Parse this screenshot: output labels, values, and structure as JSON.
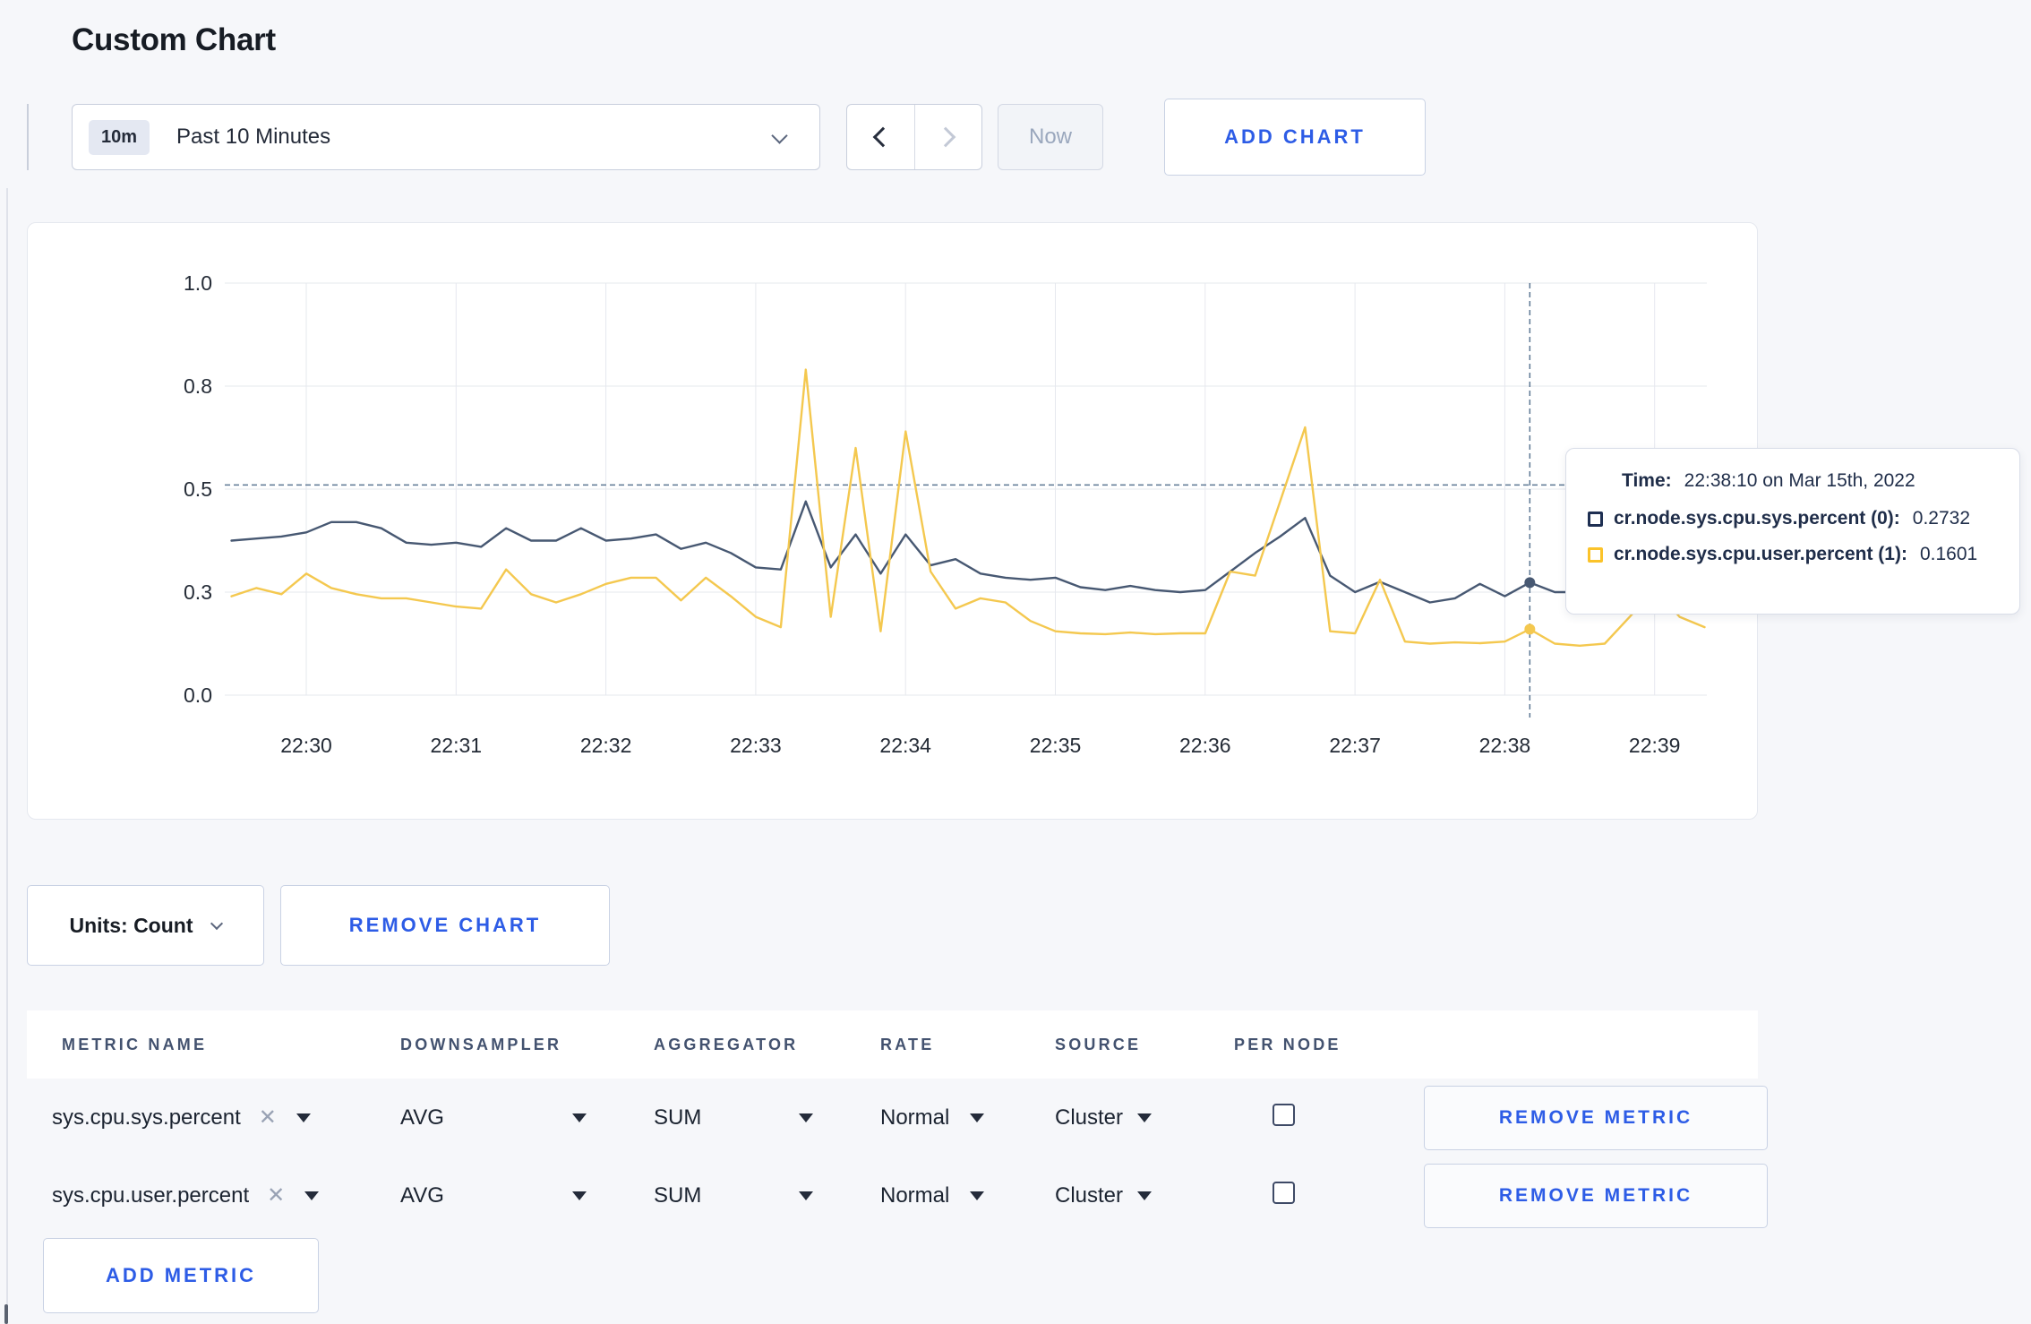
{
  "page": {
    "title": "Custom Chart"
  },
  "toolbar": {
    "time_range": {
      "badge": "10m",
      "label": "Past 10 Minutes"
    },
    "now_label": "Now",
    "add_chart_label": "ADD CHART"
  },
  "tooltip": {
    "time_label": "Time:",
    "time_value": "22:38:10 on Mar 15th, 2022",
    "series": [
      {
        "name": "cr.node.sys.cpu.sys.percent (0):",
        "value": "0.2732",
        "color": "#1e2f52"
      },
      {
        "name": "cr.node.sys.cpu.user.percent (1):",
        "value": "0.1601",
        "color": "#fbc32a"
      }
    ]
  },
  "chart_data": {
    "type": "line",
    "title": "",
    "xlabel": "",
    "ylabel": "",
    "ylim": [
      0,
      1
    ],
    "grid": true,
    "x_ticks": [
      "22:30",
      "22:31",
      "22:32",
      "22:33",
      "22:34",
      "22:35",
      "22:36",
      "22:37",
      "22:38",
      "22:39"
    ],
    "y_tick_labels": [
      "0.0",
      "0.3",
      "0.5",
      "0.8",
      "1.0"
    ],
    "y_tick_values": [
      0,
      0.25,
      0.5,
      0.75,
      1.0
    ],
    "x_start_label": "22:29:30",
    "interval_seconds": 10,
    "series": [
      {
        "name": "cr.node.sys.cpu.sys.percent",
        "color": "#475872",
        "values": [
          0.375,
          0.38,
          0.385,
          0.395,
          0.42,
          0.42,
          0.405,
          0.37,
          0.365,
          0.37,
          0.36,
          0.405,
          0.375,
          0.375,
          0.405,
          0.375,
          0.38,
          0.39,
          0.355,
          0.37,
          0.345,
          0.31,
          0.305,
          0.47,
          0.31,
          0.39,
          0.295,
          0.39,
          0.315,
          0.33,
          0.295,
          0.285,
          0.28,
          0.285,
          0.262,
          0.255,
          0.265,
          0.255,
          0.25,
          0.255,
          0.3,
          0.345,
          0.385,
          0.43,
          0.29,
          0.25,
          0.275,
          0.25,
          0.225,
          0.235,
          0.27,
          0.24,
          0.2732,
          0.25,
          0.25,
          0.24,
          0.25,
          0.25,
          0.24,
          0.25
        ]
      },
      {
        "name": "cr.node.sys.cpu.user.percent",
        "color": "#f4c84f",
        "values": [
          0.24,
          0.26,
          0.245,
          0.295,
          0.26,
          0.245,
          0.235,
          0.235,
          0.225,
          0.215,
          0.21,
          0.305,
          0.245,
          0.225,
          0.245,
          0.27,
          0.285,
          0.285,
          0.23,
          0.285,
          0.24,
          0.19,
          0.165,
          0.79,
          0.19,
          0.6,
          0.155,
          0.64,
          0.3,
          0.21,
          0.235,
          0.225,
          0.18,
          0.155,
          0.15,
          0.148,
          0.152,
          0.148,
          0.15,
          0.15,
          0.3,
          0.29,
          0.47,
          0.65,
          0.155,
          0.15,
          0.28,
          0.13,
          0.125,
          0.128,
          0.126,
          0.13,
          0.1601,
          0.125,
          0.12,
          0.125,
          0.19,
          0.26,
          0.19,
          0.165
        ]
      }
    ],
    "crosshair": {
      "time": "22:38:10",
      "index": 52,
      "y_value": 0.51
    },
    "legend_position": "tooltip"
  },
  "chart_controls": {
    "units_label": "Units: Count",
    "remove_chart_label": "REMOVE CHART"
  },
  "metrics_table": {
    "headers": [
      "METRIC NAME",
      "DOWNSAMPLER",
      "AGGREGATOR",
      "RATE",
      "SOURCE",
      "PER NODE"
    ],
    "rows": [
      {
        "metric": "sys.cpu.sys.percent",
        "downsampler": "AVG",
        "aggregator": "SUM",
        "rate": "Normal",
        "source": "Cluster",
        "per_node_checked": false,
        "remove_label": "REMOVE METRIC"
      },
      {
        "metric": "sys.cpu.user.percent",
        "downsampler": "AVG",
        "aggregator": "SUM",
        "rate": "Normal",
        "source": "Cluster",
        "per_node_checked": false,
        "remove_label": "REMOVE METRIC"
      }
    ],
    "add_metric_label": "ADD METRIC"
  },
  "icons": {
    "remove_x": "✕"
  }
}
